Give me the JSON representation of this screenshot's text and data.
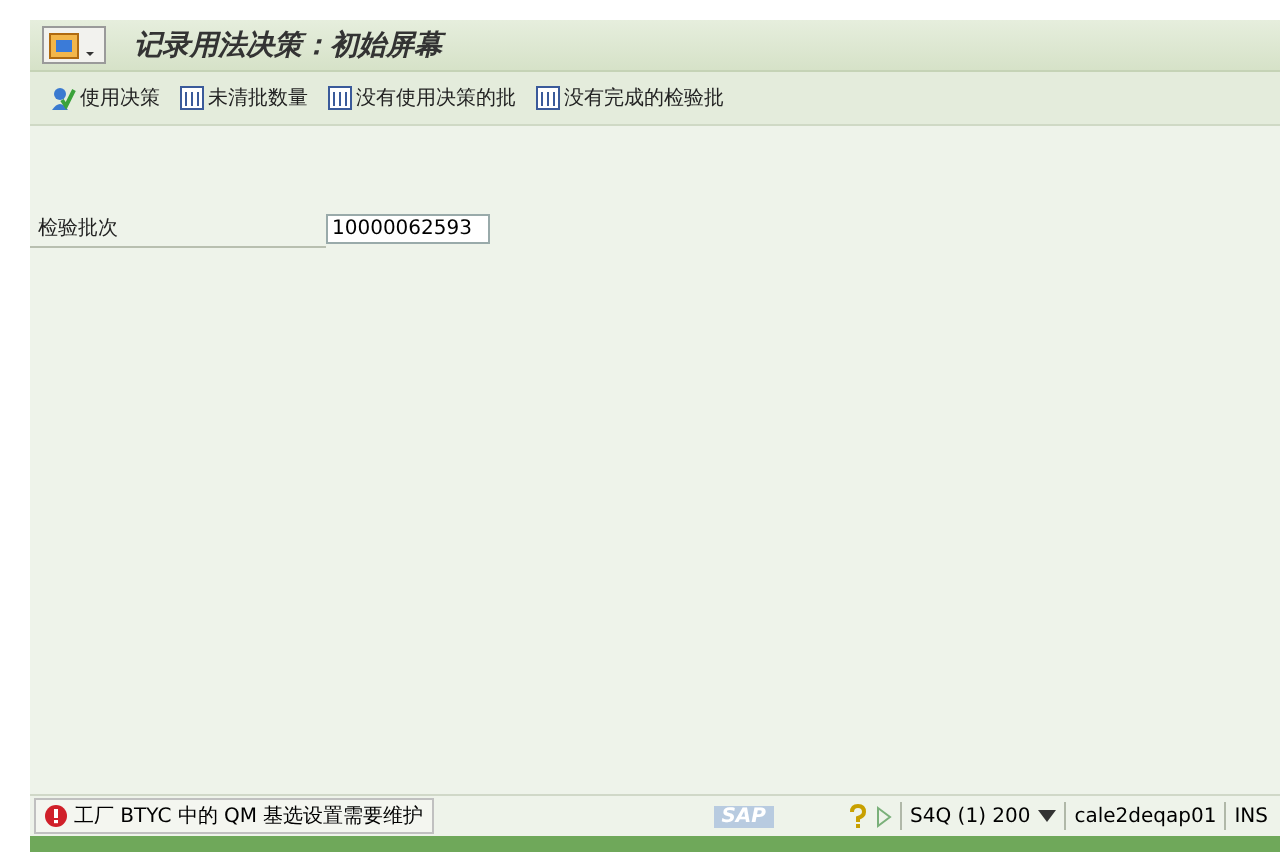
{
  "window": {
    "title": "记录用法决策：初始屏幕"
  },
  "toolbar": [
    {
      "label": "使用决策",
      "kind": "decision"
    },
    {
      "label": "未清批数量",
      "kind": "table"
    },
    {
      "label": "没有使用决策的批",
      "kind": "table"
    },
    {
      "label": "没有完成的检验批",
      "kind": "table"
    }
  ],
  "form": {
    "label": "检验批次",
    "value": "10000062593"
  },
  "status_bar": {
    "message": "工厂 BTYC 中的 QM 基选设置需要维护",
    "error": true,
    "logo": "SAP",
    "system": "S4Q (1) 200",
    "server": "cale2deqap01",
    "mode": "INS"
  }
}
